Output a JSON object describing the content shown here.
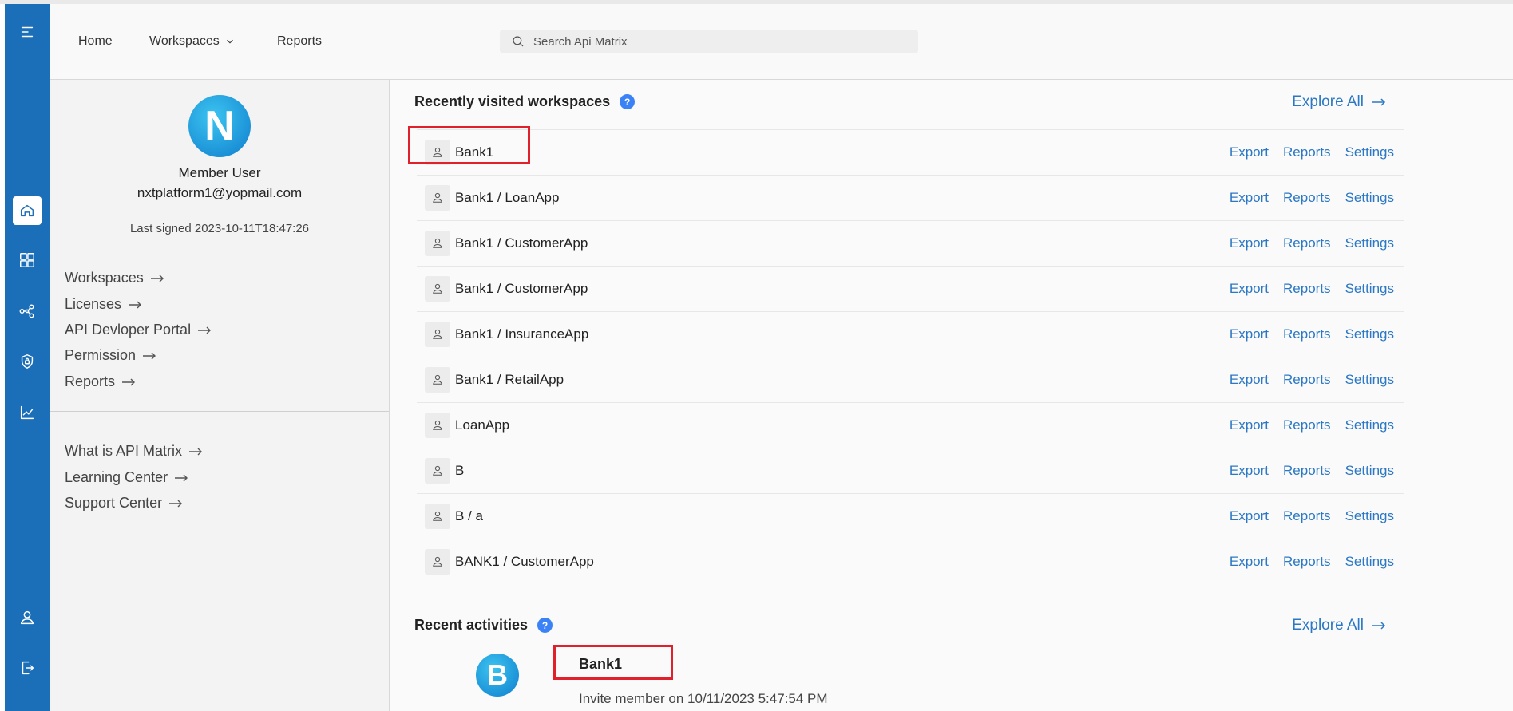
{
  "header": {
    "nav": [
      {
        "label": "Home"
      },
      {
        "label": "Workspaces"
      },
      {
        "label": "Reports"
      }
    ],
    "search_placeholder": "Search Api Matrix"
  },
  "rail": {
    "items": [
      {
        "icon": "menu-icon"
      },
      {
        "icon": "home-icon",
        "active": true
      },
      {
        "icon": "dashboard-icon"
      },
      {
        "icon": "share-nodes-icon"
      },
      {
        "icon": "shield-lock-icon"
      },
      {
        "icon": "chart-icon"
      },
      {
        "icon": "user-icon"
      },
      {
        "icon": "logout-icon"
      }
    ]
  },
  "profile": {
    "avatar_letter": "N",
    "name": "Member User",
    "email": "nxtplatform1@yopmail.com",
    "last_signed": "Last signed 2023-10-11T18:47:26",
    "links": [
      "Workspaces",
      "Licenses",
      "API Devloper Portal",
      "Permission",
      "Reports"
    ],
    "help_links": [
      "What is API Matrix",
      "Learning Center",
      "Support Center"
    ]
  },
  "recent_workspaces": {
    "title": "Recently visited workspaces",
    "explore_label": "Explore All",
    "action_labels": {
      "export": "Export",
      "reports": "Reports",
      "settings": "Settings"
    },
    "items": [
      {
        "name": "Bank1"
      },
      {
        "name": "Bank1 / LoanApp"
      },
      {
        "name": "Bank1 / CustomerApp"
      },
      {
        "name": "Bank1 / CustomerApp"
      },
      {
        "name": "Bank1 / InsuranceApp"
      },
      {
        "name": "Bank1 / RetailApp"
      },
      {
        "name": "LoanApp"
      },
      {
        "name": "B"
      },
      {
        "name": "B / a"
      },
      {
        "name": "BANK1 / CustomerApp"
      }
    ]
  },
  "recent_activities": {
    "title": "Recent activities",
    "explore_label": "Explore All",
    "items": [
      {
        "avatar_letter": "B",
        "name": "Bank1",
        "description": "Invite member on 10/11/2023 5:47:54 PM"
      }
    ]
  },
  "colors": {
    "rail": "#1b6fb9",
    "link": "#2c78c4",
    "highlight": "#e0202a",
    "help_badge": "#3b82f6"
  }
}
